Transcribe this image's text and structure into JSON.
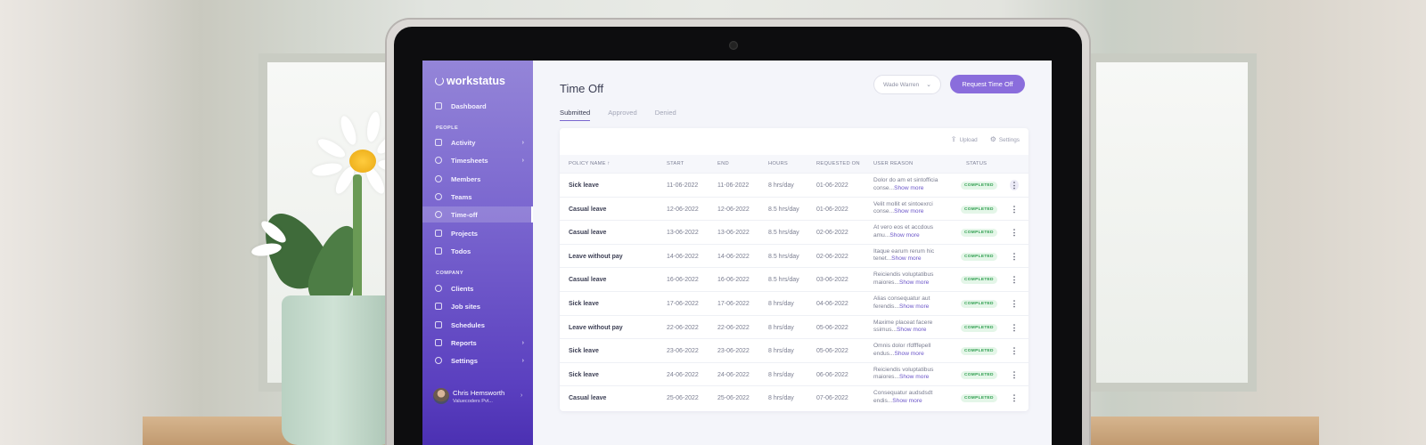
{
  "sidebar": {
    "brand": "workstatus",
    "dashboard": "Dashboard",
    "people_label": "PEOPLE",
    "people_items": [
      "Activity",
      "Timesheets",
      "Members",
      "Teams",
      "Time-off",
      "Projects",
      "Todos"
    ],
    "company_label": "COMPANY",
    "company_items": [
      "Clients",
      "Job sites",
      "Schedules",
      "Reports",
      "Settings"
    ],
    "user": {
      "name": "Chris Hemsworth",
      "company": "Valuecoders Pvt..."
    }
  },
  "header": {
    "title": "Time Off",
    "user_select": "Wade Warren",
    "request_button": "Request Time Off"
  },
  "tabs": [
    "Submitted",
    "Approved",
    "Denied"
  ],
  "toolbar": {
    "upload": "Upload",
    "settings": "Settings"
  },
  "table": {
    "columns": [
      "POLICY NAME ↑",
      "START",
      "END",
      "HOURS",
      "REQUESTED ON",
      "USER REASON",
      "STATUS"
    ],
    "show_more": "Show more",
    "rows": [
      {
        "policy": "Sick leave",
        "start": "11-06-2022",
        "end": "11-06-2022",
        "hours": "8 hrs/day",
        "requested": "01-06-2022",
        "reason": "Dolor do am et sintofficia conse...",
        "status": "COMPLETED"
      },
      {
        "policy": "Casual leave",
        "start": "12-06-2022",
        "end": "12-06-2022",
        "hours": "8.5 hrs/day",
        "requested": "01-06-2022",
        "reason": "Velit mollit et sintoexrci conse...",
        "status": "COMPLETED"
      },
      {
        "policy": "Casual leave",
        "start": "13-06-2022",
        "end": "13-06-2022",
        "hours": "8.5 hrs/day",
        "requested": "02-06-2022",
        "reason": "At vero eos et accdous amu...",
        "status": "COMPLETED"
      },
      {
        "policy": "Leave without pay",
        "start": "14-06-2022",
        "end": "14-06-2022",
        "hours": "8.5 hrs/day",
        "requested": "02-06-2022",
        "reason": "Itaque earum rerum hic tenet...",
        "status": "COMPLETED"
      },
      {
        "policy": "Casual leave",
        "start": "16-06-2022",
        "end": "16-06-2022",
        "hours": "8.5 hrs/day",
        "requested": "03-06-2022",
        "reason": "Reiciendis voluptatibus maiores...",
        "status": "COMPLETED"
      },
      {
        "policy": "Sick leave",
        "start": "17-06-2022",
        "end": "17-06-2022",
        "hours": "8 hrs/day",
        "requested": "04-06-2022",
        "reason": "Alias consequatur aut ferendis...",
        "status": "COMPLETED"
      },
      {
        "policy": "Leave without pay",
        "start": "22-06-2022",
        "end": "22-06-2022",
        "hours": "8 hrs/day",
        "requested": "05-06-2022",
        "reason": "Maxime placeat facere ssimus...",
        "status": "COMPLETED"
      },
      {
        "policy": "Sick leave",
        "start": "23-06-2022",
        "end": "23-06-2022",
        "hours": "8 hrs/day",
        "requested": "05-06-2022",
        "reason": "Omnis dolor rfdfffepell endus...",
        "status": "COMPLETED"
      },
      {
        "policy": "Sick leave",
        "start": "24-06-2022",
        "end": "24-06-2022",
        "hours": "8 hrs/day",
        "requested": "06-06-2022",
        "reason": "Reiciendis voluptatibus maiores...",
        "status": "COMPLETED"
      },
      {
        "policy": "Casual leave",
        "start": "25-06-2022",
        "end": "25-06-2022",
        "hours": "8 hrs/day",
        "requested": "07-06-2022",
        "reason": "Consequatur audsdsdt endis...",
        "status": "COMPLETED"
      }
    ]
  },
  "colors": {
    "accent": "#8a6ddc",
    "sidebar_top": "#9485d8",
    "sidebar_bottom": "#4b30b2",
    "status_green": "#2f9e4f"
  }
}
